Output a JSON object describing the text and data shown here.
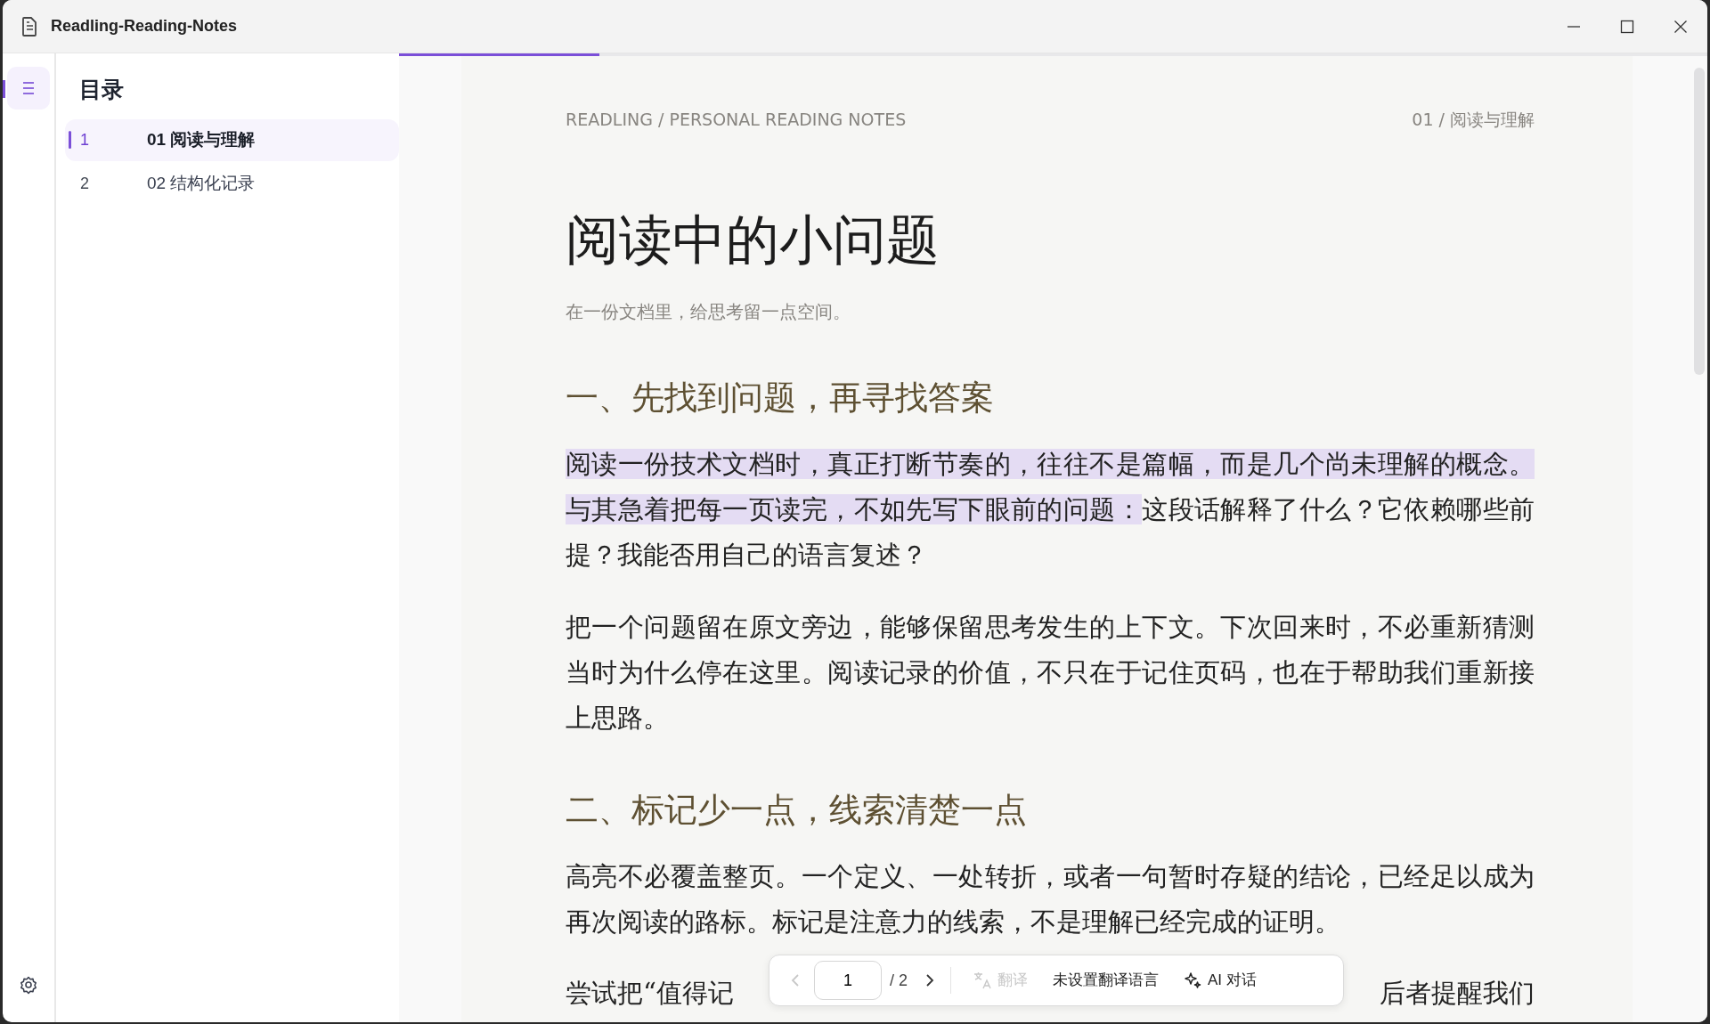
{
  "window": {
    "title": "Readling-Reading-Notes"
  },
  "sidebar_toggle": {
    "selected": true
  },
  "toc": {
    "title": "目录",
    "items": [
      {
        "number": "1",
        "label": "01 阅读与理解",
        "selected": true
      },
      {
        "number": "2",
        "label": "02 结构化记录",
        "selected": false
      }
    ]
  },
  "progress": {
    "level": 0.153
  },
  "document": {
    "breadcrumb": "READLING / PERSONAL READING NOTES",
    "chapter": "01 / 阅读与理解",
    "title": "阅读中的小问题",
    "subtitle": "在一份文档里，给思考留一点空间。",
    "blocks": [
      {
        "kind": "heading",
        "text": "一、先找到问题，再寻找答案"
      },
      {
        "kind": "paragraph",
        "segments": [
          {
            "text": "阅读一份技术文档时，真正打断节奏的，往往不是篇幅，而是几个尚未理解的概念。与其急着把每一页读完，不如先写下眼前的问题：",
            "highlighted": true
          },
          {
            "text": "这段话解释了什么？它依赖哪些前提？我能否用自己的语言复述？",
            "highlighted": false
          }
        ]
      },
      {
        "kind": "paragraph",
        "segments": [
          {
            "text": "把一个问题留在原文旁边，能够保留思考发生的上下文。下次回来时，不必重新猜测当时为什么停在这里。阅读记录的价值，不只在于记住页码，也在于帮助我们重新接上思路。",
            "highlighted": false
          }
        ]
      },
      {
        "kind": "heading",
        "text": "二、标记少一点，线索清楚一点"
      },
      {
        "kind": "paragraph",
        "segments": [
          {
            "text": "高亮不必覆盖整页。一个定义、一处转折，或者一句暂时存疑的结论，已经足以成为再次阅读的路标。标记是注意力的线索，不是理解已经完成的证明。",
            "highlighted": false
          }
        ]
      },
      {
        "kind": "covered",
        "parts": [
          "尝试把“值得记",
          "后者提醒我们"
        ]
      }
    ]
  },
  "toolbar": {
    "prev_disabled": true,
    "page": "1",
    "total": "/ 2",
    "next_disabled": false,
    "translate_label": "翻译",
    "translate_disabled": true,
    "language": "未设置翻译语言",
    "ai_label": "AI 对话"
  }
}
